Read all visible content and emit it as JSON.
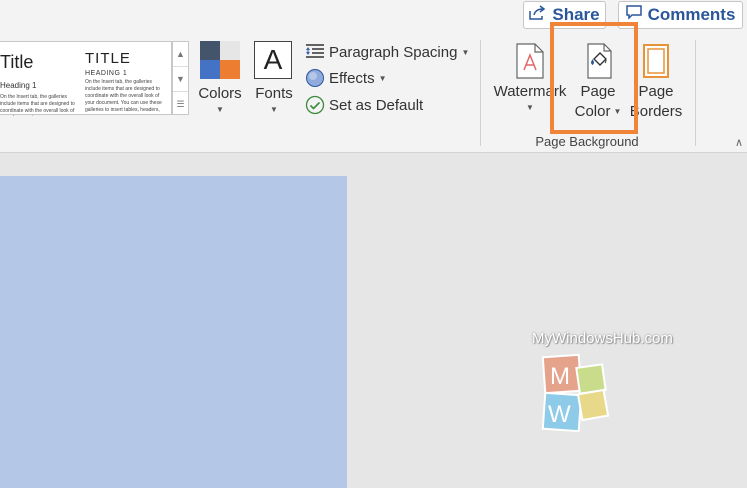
{
  "header": {
    "share_label": "Share",
    "comments_label": "Comments"
  },
  "styles_gallery": {
    "style_a": {
      "title": "Title",
      "heading": "Heading 1",
      "body": "On the Insert tab, the galleries include items that are designed to coordinate with the overall look of your document."
    },
    "style_b": {
      "title": "TITLE",
      "heading": "HEADING 1",
      "body": "On the Insert tab, the galleries include items that are designed to coordinate with the overall look of your document. You can use these galleries to insert tables, headers,"
    }
  },
  "design": {
    "colors_label": "Colors",
    "fonts_label": "Fonts",
    "fonts_icon_glyph": "A",
    "paragraph_spacing_label": "Paragraph Spacing",
    "effects_label": "Effects",
    "set_default_label": "Set as Default"
  },
  "page_background": {
    "group_label": "Page Background",
    "watermark_label": "Watermark",
    "page_color_line1": "Page",
    "page_color_line2": "Color",
    "page_borders_line1": "Page",
    "page_borders_line2": "Borders"
  },
  "document": {
    "watermark_text": "MyWindowsHub.com",
    "watermark_letter_m": "M",
    "watermark_letter_w": "W"
  },
  "colors": {
    "accent": "#2b579a",
    "highlight": "#f0853a",
    "page_color": "#b4c7e7"
  }
}
